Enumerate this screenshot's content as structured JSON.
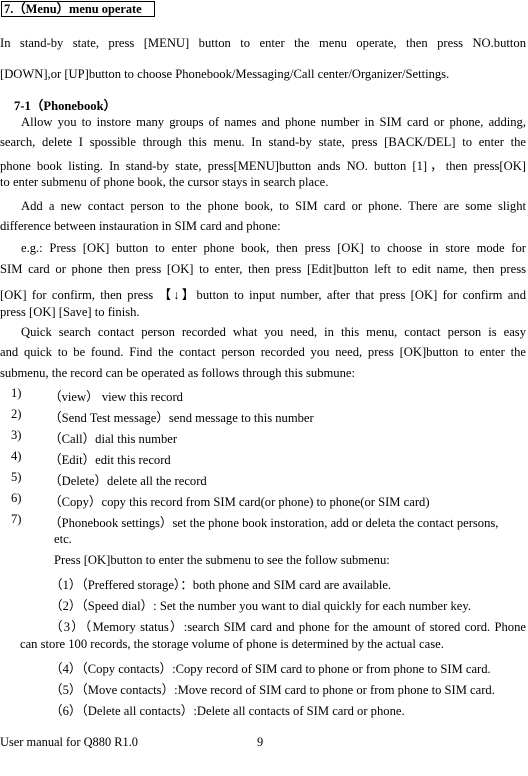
{
  "section_heading": "7.（Menu）menu operate",
  "intro": [
    "In stand-by state, press [MENU] button to enter the menu operate, then press NO.button",
    "[DOWN],or [UP]button to choose Phonebook/Messaging/Call center/Organizer/Settings."
  ],
  "subsection_title": "7-1（Phonebook）",
  "paragraphs": [
    {
      "lines": [
        "Allow you to instore many groups of names and phone number in SIM card or phone, adding,",
        "search, delete I spossible through this menu. In stand-by state, press [BACK/DEL] to enter the",
        "phone book listing. In stand-by state, press[MENU]button ands NO. button [1]，then press[OK]",
        "to enter submenu of phone book, the cursor stays in search place."
      ]
    },
    {
      "lines": [
        "Add a new contact person to the phone book, to SIM card or phone. There are some slight",
        "difference between instauration in SIM card and phone:"
      ]
    },
    {
      "lines": [
        "e.g.: Press [OK] button to enter phone book, then press [OK] to choose in store mode for",
        "SIM card or phone then press [OK] to enter, then press [Edit]button left to edit name, then press",
        "[OK] for confirm, then press 【↓】button to input number, after that press [OK] for confirm and",
        "press [OK] [Save] to finish."
      ]
    },
    {
      "lines": [
        "Quick search contact person recorded what you need, in this menu, contact person is easy",
        "and quick to be found. Find the contact person recorded you need, press [OK]button to enter the",
        "submenu, the record can be operated as follows through this submune:"
      ]
    }
  ],
  "submenu_items": [
    {
      "num": "1)",
      "text": "（view）  view this record"
    },
    {
      "num": "2)",
      "text": "（Send Test message）send message to this number"
    },
    {
      "num": "3)",
      "text": "（Call）dial this number"
    },
    {
      "num": "4)",
      "text": "（Edit）edit this record"
    },
    {
      "num": "5)",
      "text": "（Delete）delete all the record"
    },
    {
      "num": "6)",
      "text": "（Copy）copy this record from SIM card(or phone) to phone(or SIM card)"
    },
    {
      "num": "7)",
      "text": "（Phonebook settings）set the phone book instoration, add or deleta the contact persons,"
    }
  ],
  "settings": {
    "continuation": "etc.",
    "intro": "Press [OK]button to enter the submenu to see the follow submenu:",
    "items": [
      "（1）（Preffered storage）：both phone and SIM card are available.",
      "（2）（Speed dial）: Set the number you want to dial quickly for each number key.",
      "（3）（Memory status）:search SIM card and phone for the amount of stored cord. Phone",
      "can store 100 records, the storage volume of phone is determined by the actual case.",
      "（4）（Copy contacts）:Copy record of SIM card to phone or from phone to SIM card.",
      "（5）（Move contacts）:Move record of SIM card to phone or from phone to SIM card.",
      "（6）（Delete all contacts）:Delete all contacts of SIM card or phone."
    ]
  },
  "footer": {
    "manual_title": "User manual for Q880 R1.0",
    "page_number": "9"
  }
}
